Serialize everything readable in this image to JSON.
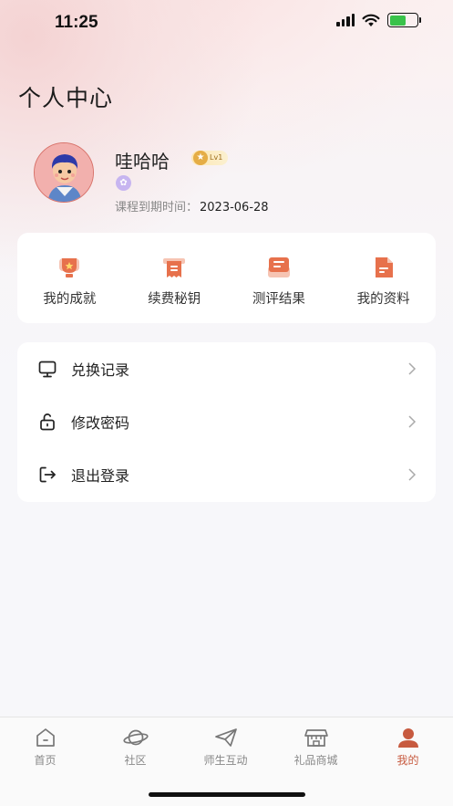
{
  "status_bar": {
    "time": "11:25"
  },
  "header": {
    "title": "个人中心"
  },
  "profile": {
    "name": "哇哈哈",
    "level": "Lv1",
    "expire_label": "课程到期时间：",
    "expire_date": "2023-06-28"
  },
  "quick_actions": [
    {
      "label": "我的成就",
      "icon": "trophy-icon"
    },
    {
      "label": "续费秘钥",
      "icon": "key-document-icon"
    },
    {
      "label": "测评结果",
      "icon": "message-card-icon"
    },
    {
      "label": "我的资料",
      "icon": "profile-file-icon"
    }
  ],
  "menu": [
    {
      "label": "兑换记录",
      "icon": "monitor-icon"
    },
    {
      "label": "修改密码",
      "icon": "lock-icon"
    },
    {
      "label": "退出登录",
      "icon": "logout-icon"
    }
  ],
  "tabbar": [
    {
      "label": "首页",
      "icon": "home-icon"
    },
    {
      "label": "社区",
      "icon": "planet-icon"
    },
    {
      "label": "师生互动",
      "icon": "paper-plane-icon"
    },
    {
      "label": "礼品商城",
      "icon": "shop-icon"
    },
    {
      "label": "我的",
      "icon": "user-icon",
      "active": true
    }
  ],
  "colors": {
    "accent": "#c75a3f",
    "icon_orange": "#e7714c",
    "background": "#f7f7fa"
  }
}
